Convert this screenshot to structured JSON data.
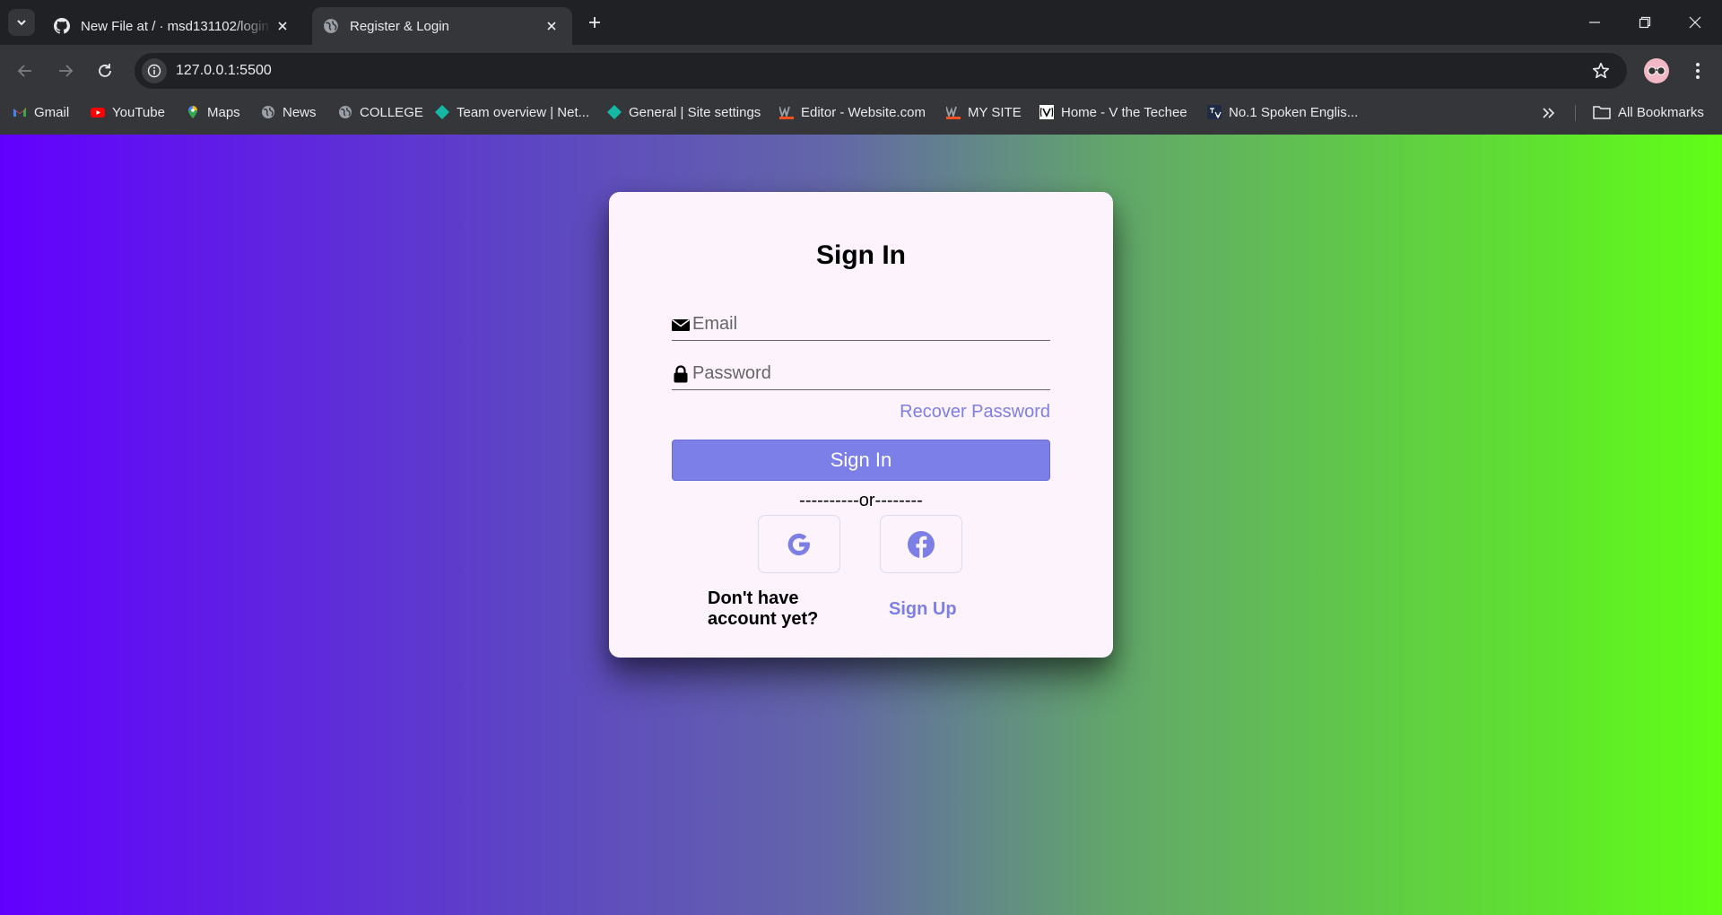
{
  "browser": {
    "tabs": [
      {
        "title": "New File at / · msd131102/login",
        "favicon": "github-icon",
        "active": false
      },
      {
        "title": "Register & Login",
        "favicon": "globe-icon",
        "active": true
      }
    ],
    "url": "127.0.0.1:5500",
    "bookmarks": [
      {
        "label": "Gmail",
        "icon": "gmail-icon"
      },
      {
        "label": "YouTube",
        "icon": "youtube-icon"
      },
      {
        "label": "Maps",
        "icon": "maps-icon"
      },
      {
        "label": "News",
        "icon": "globe-icon"
      },
      {
        "label": "COLLEGE",
        "icon": "globe-icon"
      },
      {
        "label": "Team overview | Net...",
        "icon": "netlify-icon"
      },
      {
        "label": "General | Site settings",
        "icon": "netlify-icon"
      },
      {
        "label": "Editor - Website.com",
        "icon": "website-w-icon"
      },
      {
        "label": "MY SITE",
        "icon": "website-w-icon"
      },
      {
        "label": "Home - V the Techee",
        "icon": "v-techee-icon"
      },
      {
        "label": "No.1 Spoken Englis...",
        "icon": "translate-icon"
      }
    ],
    "all_bookmarks_label": "All Bookmarks"
  },
  "login": {
    "title": "Sign In",
    "email_placeholder": "Email",
    "password_placeholder": "Password",
    "recover_label": "Recover Password",
    "signin_label": "Sign In",
    "divider_text": "----------or--------",
    "social": [
      "google-icon",
      "facebook-icon"
    ],
    "no_account_text": "Don't have account yet?",
    "signup_label": "Sign Up"
  },
  "colors": {
    "accent": "#7c7fe8",
    "card_bg": "#fdf3fd",
    "gradient_start": "#6200ff",
    "gradient_end": "#60ff16"
  }
}
